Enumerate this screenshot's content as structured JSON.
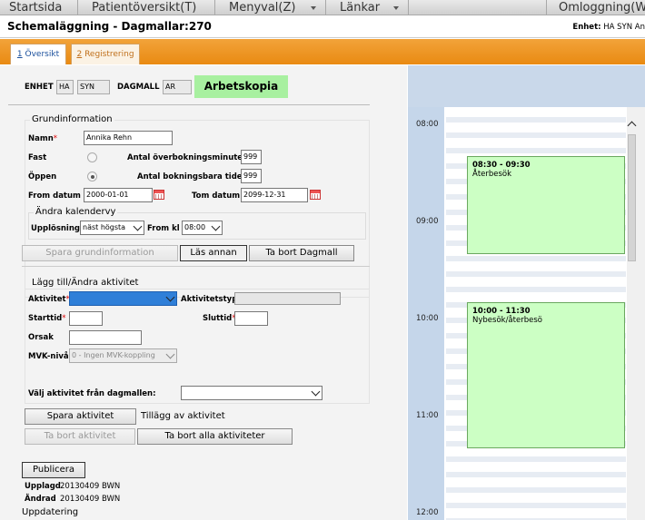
{
  "menubar": {
    "items": [
      {
        "label": "Startsida"
      },
      {
        "label": "Patientöversikt(T)"
      },
      {
        "label": "Menyval(Z)"
      },
      {
        "label": "Länkar"
      },
      {
        "label": "Omloggning(W"
      }
    ]
  },
  "header": {
    "title": "Schemaläggning - Dagmallar:270",
    "unit_label": "Enhet:",
    "unit_value": "HA SYN An"
  },
  "tabs": [
    {
      "number": "1",
      "label": "Översikt",
      "active": true
    },
    {
      "number": "2",
      "label": "Registrering",
      "active": false
    }
  ],
  "top_fields": {
    "enhet_label": "ENHET",
    "enhet_code1": "HA",
    "enhet_code2": "SYN",
    "dagmall_label": "DAGMALL",
    "dagmall_value": "AR",
    "badge": "Arbetskopia"
  },
  "grundinformation": {
    "section_title": "Grundinformation",
    "namn_label": "Namn",
    "namn_value": "Annika Rehn",
    "fast_label": "Fast",
    "oppen_label": "Öppen",
    "overbokning_label": "Antal överbokningsminuter",
    "overbokning_value": "999",
    "bokningsbara_label": "Antal bokningsbara tider",
    "bokningsbara_value": "999",
    "from_datum_label": "From datum",
    "from_datum_value": "2000-01-01",
    "tom_datum_label": "Tom datum",
    "tom_datum_value": "2099-12-31",
    "selected_status": "Öppen"
  },
  "kalendervy": {
    "section_title": "Ändra kalendervy",
    "upplosning_label": "Upplösning",
    "upplosning_value": "näst högsta",
    "from_kl_label": "From kl",
    "from_kl_value": "08:00"
  },
  "buttons_1": {
    "spara_grund": "Spara grundinformation",
    "las_annan": "Läs annan",
    "ta_bort_dagmall": "Ta bort Dagmall"
  },
  "aktivitet": {
    "section_title": "Lägg till/Ändra aktivitet",
    "aktivitet_label": "Aktivitet",
    "aktivitetstyp_label": "Aktivitetstyp",
    "starttid_label": "Starttid",
    "sluttid_label": "Sluttid",
    "orsak_label": "Orsak",
    "mvk_label": "MVK-nivå",
    "mvk_value": "0 - Ingen MVK-koppling",
    "valj_label": "Välj aktivitet från dagmallen:"
  },
  "buttons_2": {
    "spara_aktivitet": "Spara aktivitet",
    "tillagg_text": "Tillägg av aktivitet",
    "ta_bort_aktivitet": "Ta bort aktivitet",
    "ta_bort_alla": "Ta bort alla aktiviteter",
    "publicera": "Publicera"
  },
  "footer": {
    "upplagd_label": "Upplagd",
    "upplagd_value": "20130409 BWN",
    "andrad_label": "Ändrad",
    "andrad_value": "20130409 BWN",
    "uppdatering": "Uppdatering"
  },
  "calendar": {
    "times": [
      "08:00",
      "09:00",
      "10:00",
      "11:00",
      "12:00"
    ],
    "appointments": [
      {
        "time": "08:30 - 09:30",
        "name": "Återbesök"
      },
      {
        "time": "10:00 - 11:30",
        "name": "Nybesök/återbesö"
      }
    ]
  },
  "colors": {
    "tab_bar": "#f0a030",
    "badge_green": "#a8f0a0",
    "appointment_green": "#ccffc4",
    "aktivitet_select_blue": "#2f7fd8",
    "calendar_header": "#c9d8ea"
  }
}
